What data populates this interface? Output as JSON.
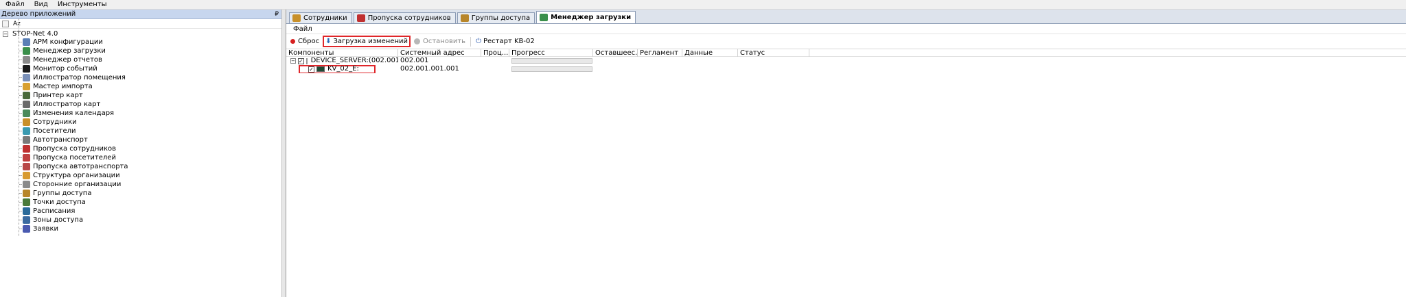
{
  "menu": [
    "Файл",
    "Вид",
    "Инструменты"
  ],
  "left_panel": {
    "title": "Дерево приложений",
    "pin": "₽",
    "sort_label": "Аz",
    "root": "STOP-Net 4.0",
    "items": [
      {
        "label": "АРМ конфигурации",
        "icon": "config-icon",
        "color": "#5a7fb5"
      },
      {
        "label": "Менеджер загрузки",
        "icon": "download-manager-icon",
        "color": "#3a8f4a"
      },
      {
        "label": "Менеджер отчетов",
        "icon": "reports-icon",
        "color": "#8a8a8a"
      },
      {
        "label": "Монитор событий",
        "icon": "events-monitor-icon",
        "color": "#1a1a1a"
      },
      {
        "label": "Иллюстратор помещения",
        "icon": "room-illustrator-icon",
        "color": "#7a90b8"
      },
      {
        "label": "Мастер импорта",
        "icon": "import-wizard-icon",
        "color": "#d8a030"
      },
      {
        "label": "Принтер карт",
        "icon": "card-printer-icon",
        "color": "#4a6a3a"
      },
      {
        "label": "Иллюстратор карт",
        "icon": "card-illustrator-icon",
        "color": "#6a6a6a"
      },
      {
        "label": "Изменения календаря",
        "icon": "calendar-icon",
        "color": "#4a8a5a"
      },
      {
        "label": "Сотрудники",
        "icon": "employees-icon",
        "color": "#c8902a"
      },
      {
        "label": "Посетители",
        "icon": "visitors-icon",
        "color": "#3a9ab0"
      },
      {
        "label": "Автотранспорт",
        "icon": "car-icon",
        "color": "#7a7a7a"
      },
      {
        "label": "Пропуска сотрудников",
        "icon": "employee-pass-icon",
        "color": "#c03030"
      },
      {
        "label": "Пропуска посетителей",
        "icon": "visitor-pass-icon",
        "color": "#c04040"
      },
      {
        "label": "Пропуска автотранспорта",
        "icon": "vehicle-pass-icon",
        "color": "#b84848"
      },
      {
        "label": "Структура организации",
        "icon": "org-structure-icon",
        "color": "#d89a30"
      },
      {
        "label": "Сторонние организации",
        "icon": "external-orgs-icon",
        "color": "#8a8a8a"
      },
      {
        "label": "Группы доступа",
        "icon": "access-groups-icon",
        "color": "#b8862a"
      },
      {
        "label": "Точки доступа",
        "icon": "access-points-icon",
        "color": "#4a7a3a"
      },
      {
        "label": "Расписания",
        "icon": "schedule-icon",
        "color": "#2a6a9a"
      },
      {
        "label": "Зоны доступа",
        "icon": "access-zones-icon",
        "color": "#3a6aa0"
      },
      {
        "label": "Заявки",
        "icon": "requests-icon",
        "color": "#4a5ab0"
      }
    ]
  },
  "tabs": [
    {
      "label": "Сотрудники",
      "icon": "employees-icon",
      "color": "#c8902a",
      "active": false
    },
    {
      "label": "Пропуска сотрудников",
      "icon": "employee-pass-icon",
      "color": "#c03030",
      "active": false
    },
    {
      "label": "Группы доступа",
      "icon": "access-groups-icon",
      "color": "#b8862a",
      "active": false
    },
    {
      "label": "Менеджер загрузки",
      "icon": "download-manager-icon",
      "color": "#3a8f4a",
      "active": true
    }
  ],
  "sub_menu": "Файл",
  "toolbar": {
    "reset": "Сброс",
    "upload": "Загрузка изменений",
    "stop": "Остановить",
    "restart": "Рестарт KB-02"
  },
  "grid": {
    "columns": [
      "Компоненты",
      "Системный адрес",
      "Проц...",
      "Прогресс",
      "Оставшеес...",
      "Регламент",
      "Данные",
      "Статус"
    ],
    "rows": [
      {
        "component": "DEVICE_SERVER:(002.001)",
        "address": "002.001",
        "progress": 0
      },
      {
        "component": "KV_02_E:",
        "address": "002.001.001.001",
        "progress": 0
      }
    ]
  },
  "colors": {
    "highlight": "#e0262a",
    "header_blue": "#c7d6ee"
  }
}
